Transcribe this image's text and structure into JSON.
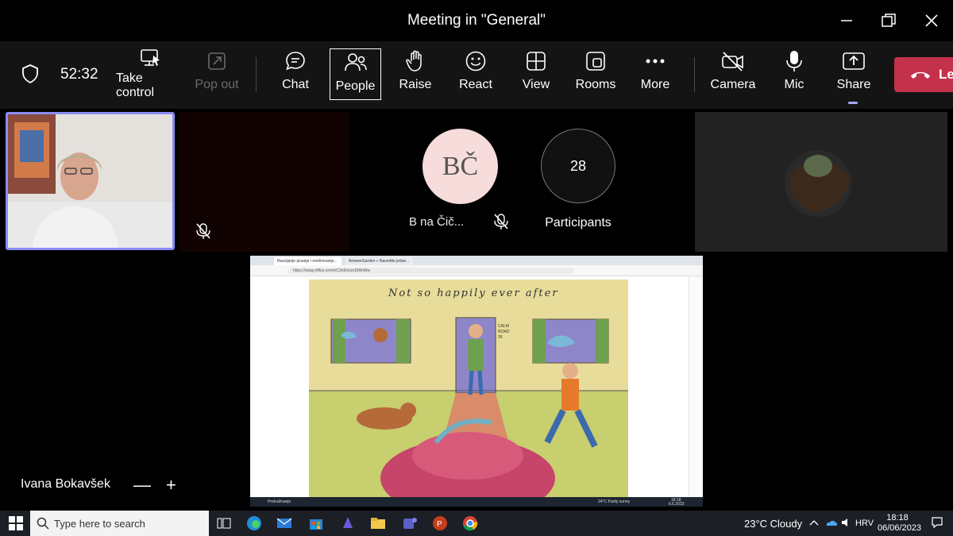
{
  "window": {
    "title": "Meeting in \"General\""
  },
  "toolbar": {
    "timer": "52:32",
    "buttons": [
      {
        "label": "Take control"
      },
      {
        "label": "Pop out"
      },
      {
        "label": "Chat"
      },
      {
        "label": "People"
      },
      {
        "label": "Raise"
      },
      {
        "label": "React"
      },
      {
        "label": "View"
      },
      {
        "label": "Rooms"
      },
      {
        "label": "More"
      },
      {
        "label": "Camera"
      },
      {
        "label": "Mic"
      },
      {
        "label": "Share"
      }
    ],
    "leave_label": "Le"
  },
  "tiles": {
    "bc_initials": "BČ",
    "bc_name": "B     na Čič...",
    "participants_count": "28",
    "participants_label": "Participants"
  },
  "presenter": {
    "name": "Ivana Bokavšek",
    "zoom_out": "—",
    "zoom_in": "+"
  },
  "shared_screen": {
    "tab1": "Razvijanje pisanja i vrednovanje...",
    "tab2": "AnswerGarden » Navedite jedan...",
    "url": "https://sway.office.com/nC3n6nUzsDfAhWw",
    "drawing_title": "Not so happily ever after",
    "sign": "CALM ROAD 35",
    "taskbar_search": "Pretraživanje",
    "taskbar_weather": "24°C  Partly sunny",
    "taskbar_time": "18:18",
    "taskbar_date": "6.6.2023"
  },
  "taskbar": {
    "search_placeholder": "Type here to search",
    "weather": "23°C  Cloudy",
    "language": "HRV",
    "time": "18:18",
    "date": "06/06/2023"
  }
}
